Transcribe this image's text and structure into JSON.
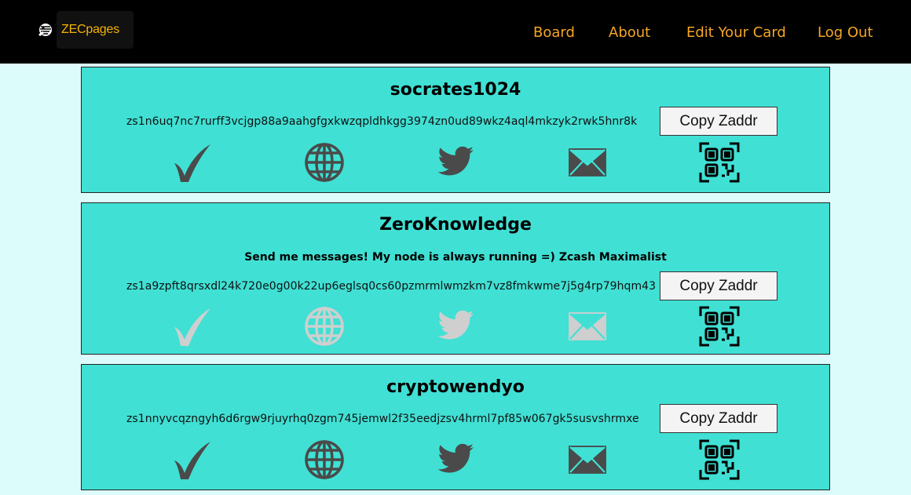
{
  "nav": {
    "brand": "ZECpages",
    "links": [
      "Board",
      "About",
      "Edit Your Card",
      "Log Out"
    ]
  },
  "colors": {
    "accent": "#f5a623",
    "card": "#40e0d4",
    "background": "#dcfcfc",
    "icon_active": "#4a4a4a",
    "icon_inactive": "#cfcfcf"
  },
  "cards": [
    {
      "username": "socrates1024",
      "description": "",
      "zaddr": "zs1n6uq7nc7rurff3vcjgp88a9aahgfgxkwzqpldhkgg3974zn0ud89wkz4aql4mkzyk2rwk5hnr8k",
      "copy_label": "Copy Zaddr",
      "icons": {
        "verified": "check-icon",
        "website": "globe-icon",
        "twitter": "twitter-icon",
        "email": "mail-icon",
        "qr": "qr-code-icon"
      },
      "active": true
    },
    {
      "username": "ZeroKnowledge",
      "description": "Send me messages! My node is always running =) Zcash Maximalist",
      "zaddr": "zs1a9zpft8qrsxdl24k720e0g00k22up6eglsq0cs60pzmrmlwmzkm7vz8fmkwme7j5g4rp79hqm43",
      "copy_label": "Copy Zaddr",
      "icons": {
        "verified": "check-icon",
        "website": "globe-icon",
        "twitter": "twitter-icon",
        "email": "mail-icon",
        "qr": "qr-code-icon"
      },
      "active": false
    },
    {
      "username": "cryptowendyo",
      "description": "",
      "zaddr": "zs1nnyvcqzngyh6d6rgw9rjuyrhq0zgm745jemwl2f35eedjzsv4hrml7pf85w067gk5susvshrmxe",
      "copy_label": "Copy Zaddr",
      "icons": {
        "verified": "check-icon",
        "website": "globe-icon",
        "twitter": "twitter-icon",
        "email": "mail-icon",
        "qr": "qr-code-icon"
      },
      "active": true
    }
  ]
}
